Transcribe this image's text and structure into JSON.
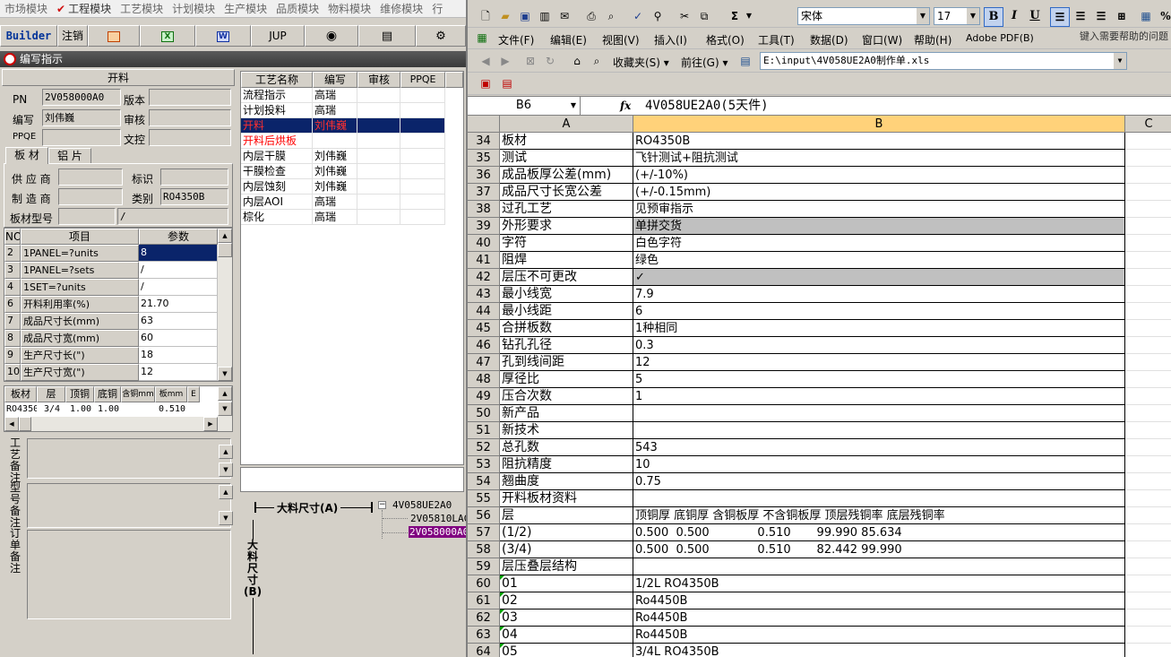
{
  "left": {
    "top_menu": [
      "市场模块",
      "工程模块",
      "工艺模块",
      "计划模块",
      "生产模块",
      "品质模块",
      "物料模块",
      "维修模块",
      "行"
    ],
    "toolbar": {
      "builder": "Builder",
      "logout": "注销",
      "jup": "JUP"
    },
    "window_title": "编写指示",
    "form": {
      "section_title": "开料",
      "pn_label": "PN",
      "pn_value": "2V058000A0",
      "version_label": "版本",
      "version_value": "",
      "author_label": "编写",
      "author_value": "刘伟巍",
      "review_label": "审核",
      "review_value": "",
      "ppqe_label": "PPQE",
      "ppqe_value": "",
      "doc_label": "文控",
      "doc_value": ""
    },
    "tabs": [
      "板 材",
      "铝 片"
    ],
    "material": {
      "supplier_label": "供 应 商",
      "supplier_value": "",
      "mark_label": "标识",
      "mark_value": "",
      "maker_label": "制 造 商",
      "maker_value": "",
      "type_label": "类别",
      "type_value": "RO4350B",
      "model_label": "板材型号",
      "model_value": "",
      "model_value2": "/"
    },
    "param_table": {
      "headers": [
        "NO",
        "项目",
        "参数"
      ],
      "rows": [
        {
          "no": "2",
          "item": "1PANEL=?units",
          "value": "8"
        },
        {
          "no": "3",
          "item": "1PANEL=?sets",
          "value": "/"
        },
        {
          "no": "4",
          "item": "1SET=?units",
          "value": "/"
        },
        {
          "no": "6",
          "item": "开料利用率(%)",
          "value": "21.70"
        },
        {
          "no": "7",
          "item": "成品尺寸长(mm)",
          "value": "63"
        },
        {
          "no": "8",
          "item": "成品尺寸宽(mm)",
          "value": "60"
        },
        {
          "no": "9",
          "item": "生产尺寸长(\")",
          "value": "18"
        },
        {
          "no": "10",
          "item": "生产尺寸宽(\")",
          "value": "12"
        }
      ]
    },
    "layer_table": {
      "headers": [
        "板材",
        "层",
        "顶铜",
        "底铜",
        "含铜mm",
        "板mm",
        "E"
      ],
      "rows": [
        {
          "material": "RO4350B",
          "layer": "3/4",
          "top": "1.00",
          "bottom": "1.00",
          "cu": "",
          "board": "0.510"
        }
      ]
    },
    "notes": {
      "process_note": "工艺备注",
      "model_note": "型号备注",
      "order_note": "订单备注"
    },
    "process_list": {
      "headers": [
        "工艺名称",
        "编写",
        "审核",
        "PPQE"
      ],
      "rows": [
        {
          "name": "流程指示",
          "author": "高瑞",
          "style": "normal"
        },
        {
          "name": "计划投料",
          "author": "高瑞",
          "style": "normal"
        },
        {
          "name": "开料",
          "author": "刘伟巍",
          "style": "selected"
        },
        {
          "name": "开料后烘板",
          "author": "",
          "style": "red"
        },
        {
          "name": "内层干膜",
          "author": "刘伟巍",
          "style": "normal"
        },
        {
          "name": "干膜检查",
          "author": "刘伟巍",
          "style": "normal"
        },
        {
          "name": "内层蚀刻",
          "author": "刘伟巍",
          "style": "normal"
        },
        {
          "name": "内层AOI",
          "author": "高瑞",
          "style": "normal"
        },
        {
          "name": "棕化",
          "author": "高瑞",
          "style": "normal"
        }
      ]
    },
    "diagram": {
      "size_a": "大料尺寸(A)",
      "size_b": "大料尺寸(B)"
    },
    "tree": {
      "root": "4V058UE2A0",
      "child1": "2V05810LAC",
      "child2": "2V058000A0"
    }
  },
  "excel": {
    "font_name": "宋体",
    "font_size": "17",
    "menus": [
      "文件(F)",
      "编辑(E)",
      "视图(V)",
      "插入(I)",
      "格式(O)",
      "工具(T)",
      "数据(D)",
      "窗口(W)",
      "帮助(H)",
      "Adobe PDF(B)"
    ],
    "help_placeholder": "键入需要帮助的问题",
    "favorites": "收藏夹(S)",
    "goto": "前往(G)",
    "address": "E:\\input\\4V058UE2A0制作单.xls",
    "name_box": "B6",
    "fx": "fx",
    "formula": "4V058UE2A0(5天件)",
    "columns": [
      "A",
      "B",
      "C"
    ],
    "rows": [
      {
        "n": "34",
        "a": "板材",
        "b": "RO4350B"
      },
      {
        "n": "35",
        "a": "测试",
        "b": "飞针测试+阻抗测试"
      },
      {
        "n": "36",
        "a": "成品板厚公差(mm)",
        "b": "(+/-10%)"
      },
      {
        "n": "37",
        "a": "成品尺寸长宽公差",
        "b": "(+/-0.15mm)"
      },
      {
        "n": "38",
        "a": "过孔工艺",
        "b": "见预审指示"
      },
      {
        "n": "39",
        "a": "外形要求",
        "b": "单拼交货",
        "gray": true
      },
      {
        "n": "40",
        "a": "字符",
        "b": "白色字符"
      },
      {
        "n": "41",
        "a": "阻焊",
        "b": "绿色"
      },
      {
        "n": "42",
        "a": "层压不可更改",
        "b": "✓",
        "gray": true
      },
      {
        "n": "43",
        "a": "最小线宽",
        "b": "7.9"
      },
      {
        "n": "44",
        "a": "最小线距",
        "b": "6"
      },
      {
        "n": "45",
        "a": "合拼板数",
        "b": "1种相同"
      },
      {
        "n": "46",
        "a": "钻孔孔径",
        "b": "0.3"
      },
      {
        "n": "47",
        "a": "孔到线间距",
        "b": "12"
      },
      {
        "n": "48",
        "a": "厚径比",
        "b": "5"
      },
      {
        "n": "49",
        "a": "压合次数",
        "b": "1"
      },
      {
        "n": "50",
        "a": "新产品",
        "b": ""
      },
      {
        "n": "51",
        "a": "新技术",
        "b": ""
      },
      {
        "n": "52",
        "a": "总孔数",
        "b": "543"
      },
      {
        "n": "53",
        "a": "阻抗精度",
        "b": "10"
      },
      {
        "n": "54",
        "a": "翘曲度",
        "b": "0.75"
      },
      {
        "n": "55",
        "a": "开料板材资料",
        "b": ""
      },
      {
        "n": "56",
        "a": "层",
        "b": "顶铜厚 底铜厚 含铜板厚 不含铜板厚 顶层残铜率 底层残铜率"
      },
      {
        "n": "57",
        "a": "(1/2)",
        "b": "0.500  0.500             0.510       99.990 85.634"
      },
      {
        "n": "58",
        "a": "(3/4)",
        "b": "0.500  0.500             0.510       82.442 99.990"
      },
      {
        "n": "59",
        "a": "层压叠层结构",
        "b": ""
      },
      {
        "n": "60",
        "a": "01",
        "b": "1/2L RO4350B",
        "mark": true
      },
      {
        "n": "61",
        "a": "02",
        "b": "Ro4450B",
        "mark": true
      },
      {
        "n": "62",
        "a": "03",
        "b": "Ro4450B",
        "mark": true
      },
      {
        "n": "63",
        "a": "04",
        "b": "Ro4450B",
        "mark": true
      },
      {
        "n": "64",
        "a": "05",
        "b": "3/4L RO4350B",
        "mark": true
      }
    ]
  }
}
